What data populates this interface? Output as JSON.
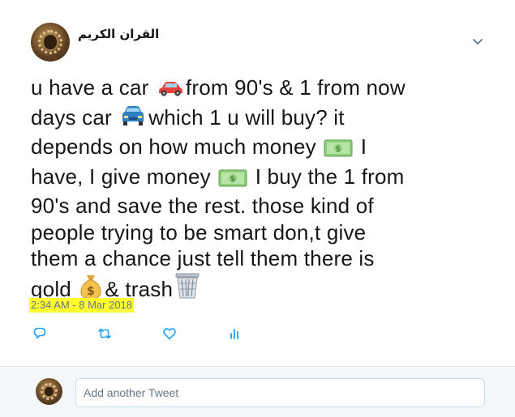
{
  "tweet": {
    "author_name": "القران الكريم",
    "text_segments": [
      "u have a car ",
      "from 90's & 1 from now days car ",
      "which 1 u will buy? it depends on how much money ",
      " I have, I give money ",
      " I buy the 1 from 90's and save the rest. those kind of people trying to be smart don,t give them a chance just tell them there is gold ",
      "& trash"
    ],
    "emojis": [
      "red-car-emoji",
      "blue-car-emoji",
      "dollar-bill-emoji",
      "dollar-bill-emoji",
      "money-bag-emoji",
      "wastebasket-emoji"
    ],
    "timestamp": "2:34 AM - 8 Mar 2018"
  },
  "actions": [
    "reply-icon",
    "retweet-icon",
    "like-icon",
    "analytics-icon"
  ],
  "reply": {
    "placeholder": "Add another Tweet"
  },
  "colors": {
    "text": "#14171a",
    "muted": "#657786",
    "highlight": "#ffff2e",
    "icon_accent": "#1da1f2",
    "reply_bg": "#f5f8fa"
  }
}
